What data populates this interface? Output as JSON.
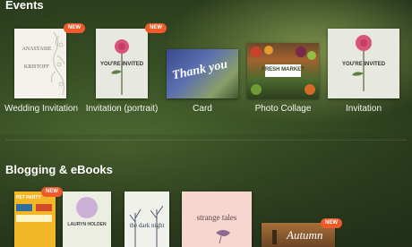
{
  "sections": [
    {
      "title": "Events",
      "items": [
        {
          "label": "Wedding Invitation",
          "badge": "NEW",
          "thumb_title": "ANASTASIE",
          "thumb_sub": "KRISTOFF"
        },
        {
          "label": "Invitation (portrait)",
          "badge": "NEW",
          "thumb_text": "YOU'RE INVITED"
        },
        {
          "label": "Card",
          "thumb_text": "Thank you"
        },
        {
          "label": "Photo Collage",
          "thumb_text": "FRESH MARKET"
        },
        {
          "label": "Invitation",
          "thumb_text": "YOU'RE INVITED"
        }
      ]
    },
    {
      "title": "Blogging & eBooks",
      "items": [
        {
          "badge": "NEW",
          "thumb_text": "PET PARTY"
        },
        {
          "thumb_text": "LAURYN HOLDEN"
        },
        {
          "thumb_text": "the dark night"
        },
        {
          "thumb_text": "strange tales"
        },
        {
          "badge": "NEW",
          "thumb_text": "Autumn"
        }
      ]
    }
  ],
  "colors": {
    "badge": "#f05a2a",
    "accent_pink": "#d9547a",
    "background": "#3a5226"
  }
}
